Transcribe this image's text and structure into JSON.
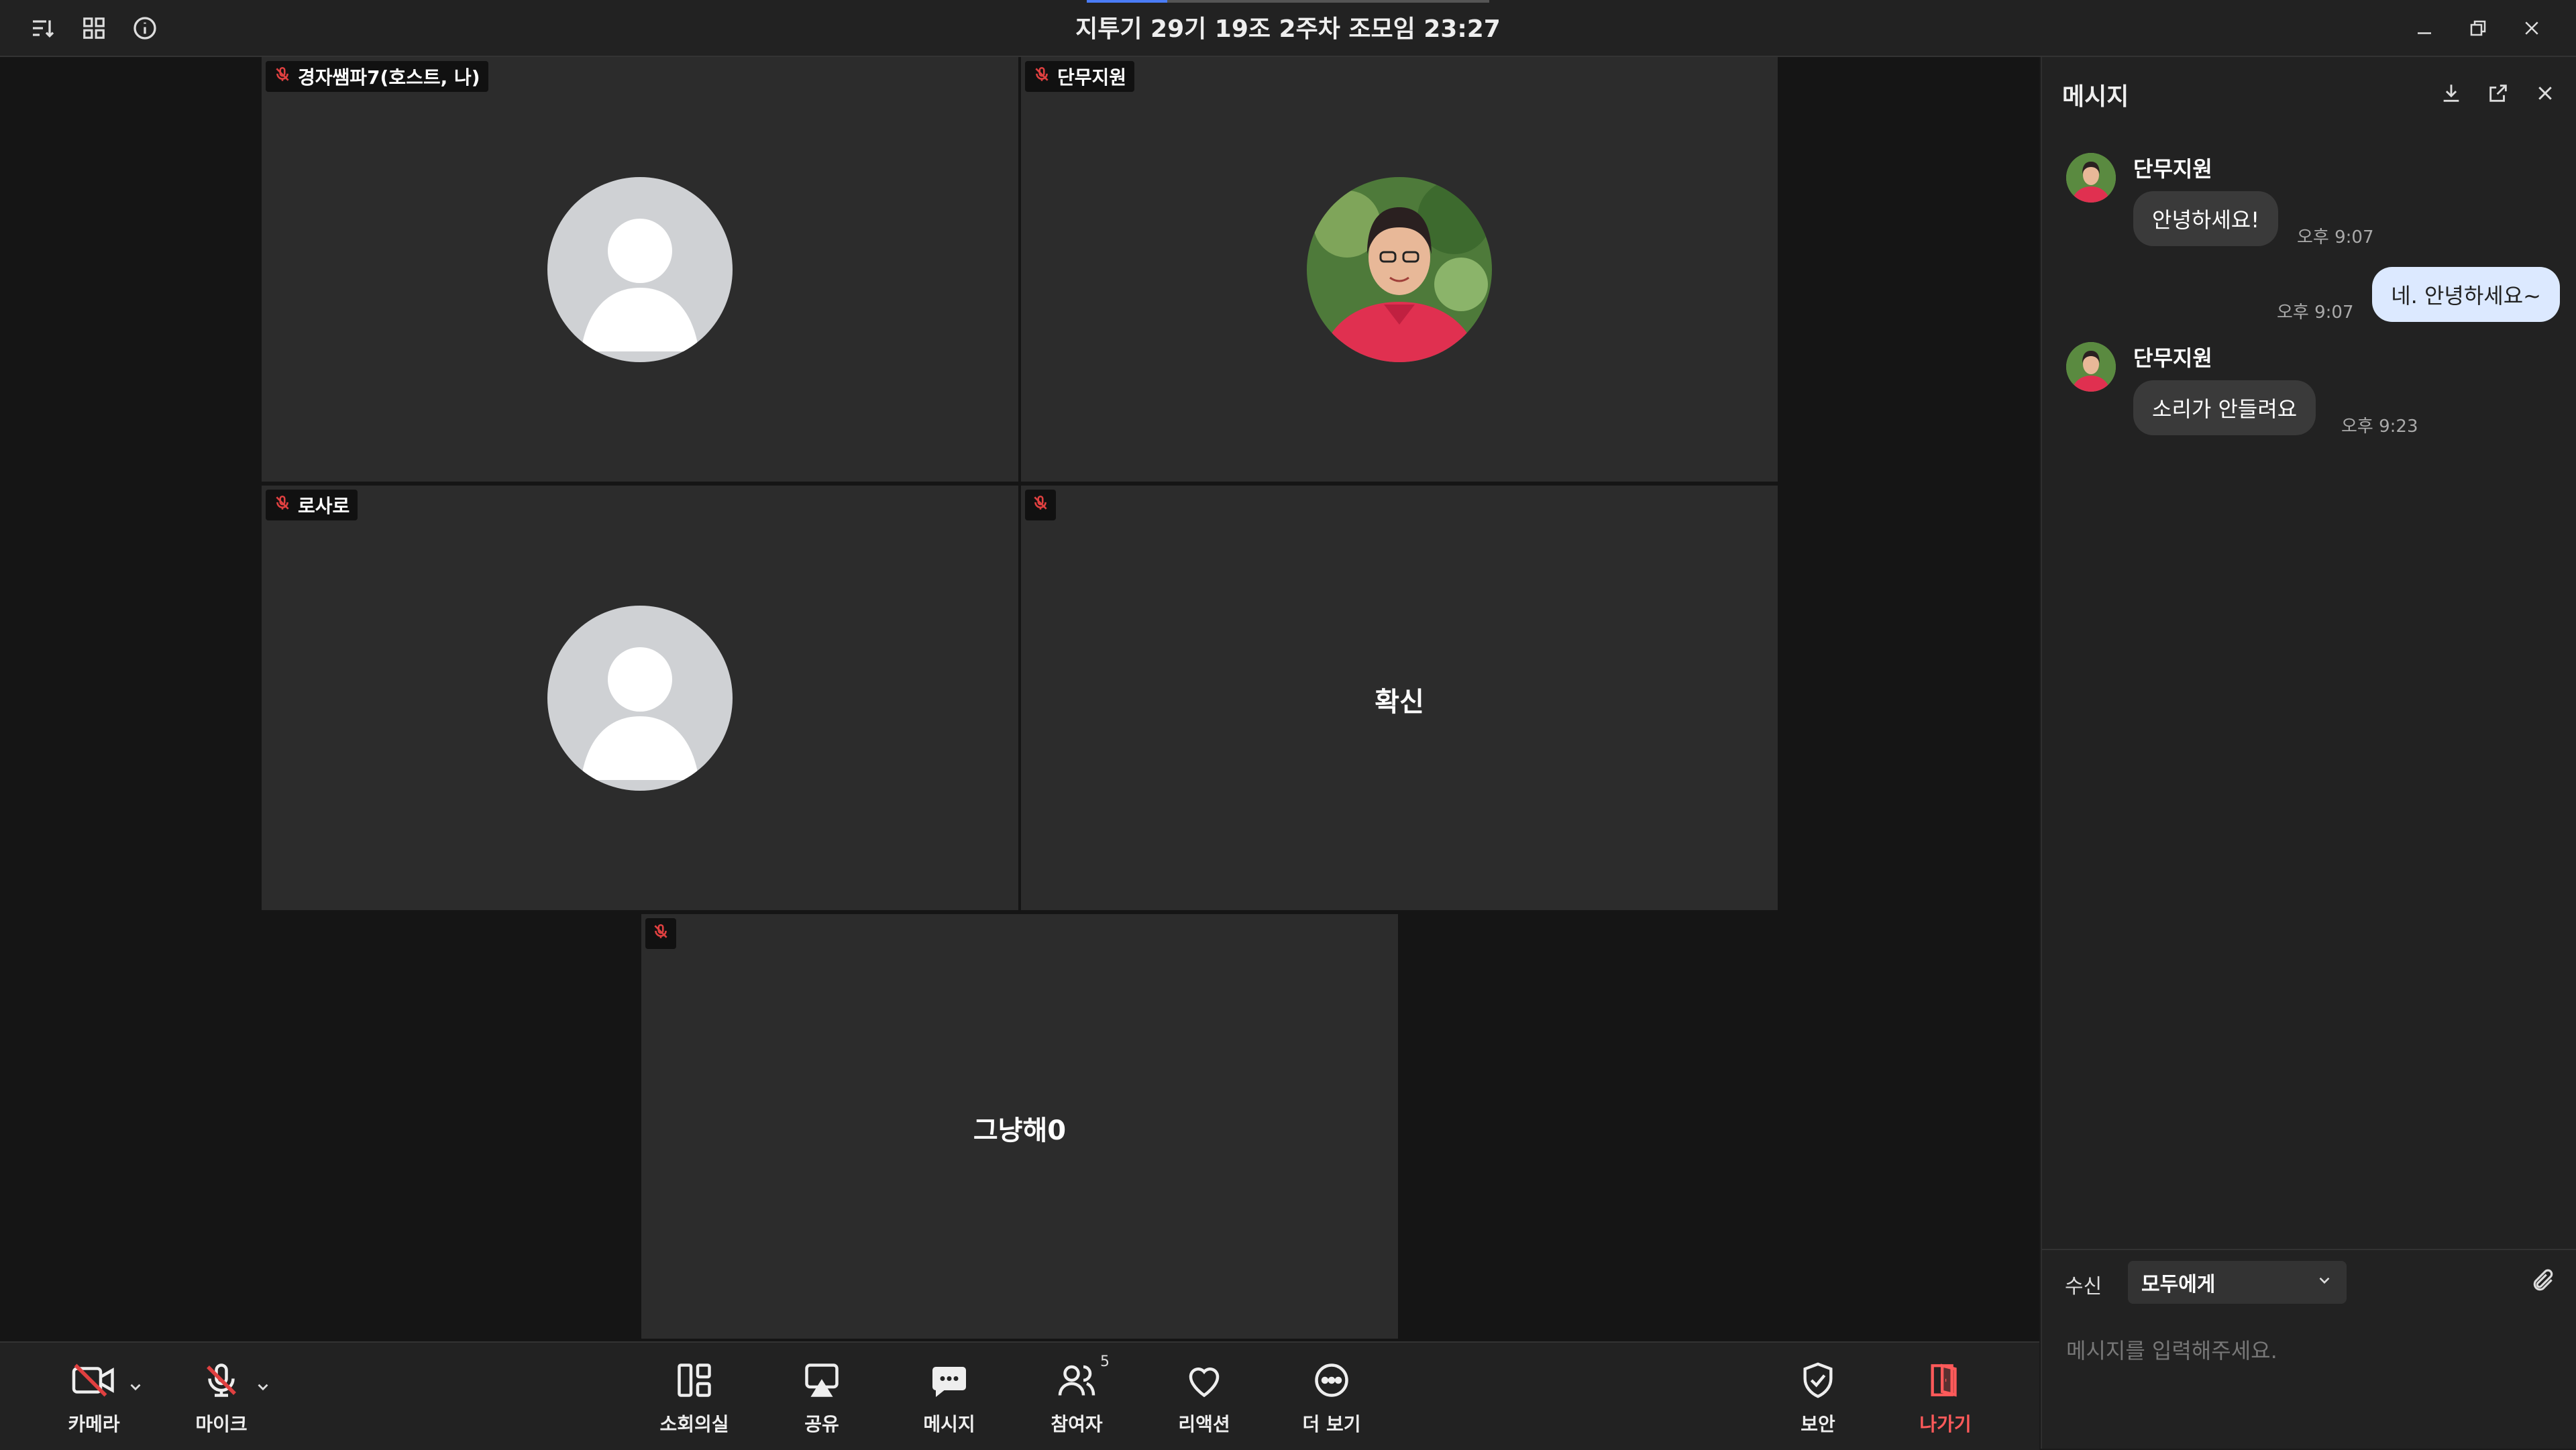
{
  "title": "지투기 29기 19조 2주차 조모임 23:27",
  "tiles": [
    {
      "name": "경자쌤파7(호스트, 나)",
      "center": ""
    },
    {
      "name": "단무지원",
      "center": ""
    },
    {
      "name": "로사로",
      "center": ""
    },
    {
      "name": "",
      "center": "확신"
    },
    {
      "name": "",
      "center": "그냥해0"
    }
  ],
  "chat": {
    "title": "메시지",
    "messages": [
      {
        "sender": "단무지원",
        "text": "안녕하세요!",
        "time": "오후 9:07"
      },
      {
        "text": "네. 안녕하세요~",
        "time": "오후 9:07"
      },
      {
        "sender": "단무지원",
        "text": "소리가 안들려요",
        "time": "오후 9:23"
      }
    ],
    "recipient_label": "수신",
    "recipient_value": "모두에게",
    "input_placeholder": "메시지를 입력해주세요."
  },
  "toolbar": {
    "camera": "카메라",
    "mic": "마이크",
    "breakout": "소회의실",
    "share": "공유",
    "messages": "메시지",
    "participants": "참여자",
    "participants_count": "5",
    "reaction": "리액션",
    "more": "더 보기",
    "security": "보안",
    "leave": "나가기"
  },
  "colors": {
    "accent": "#4a7cf6",
    "leave": "#ff5a5a",
    "muted": "#e04040",
    "my_bubble": "#dce9ff"
  }
}
